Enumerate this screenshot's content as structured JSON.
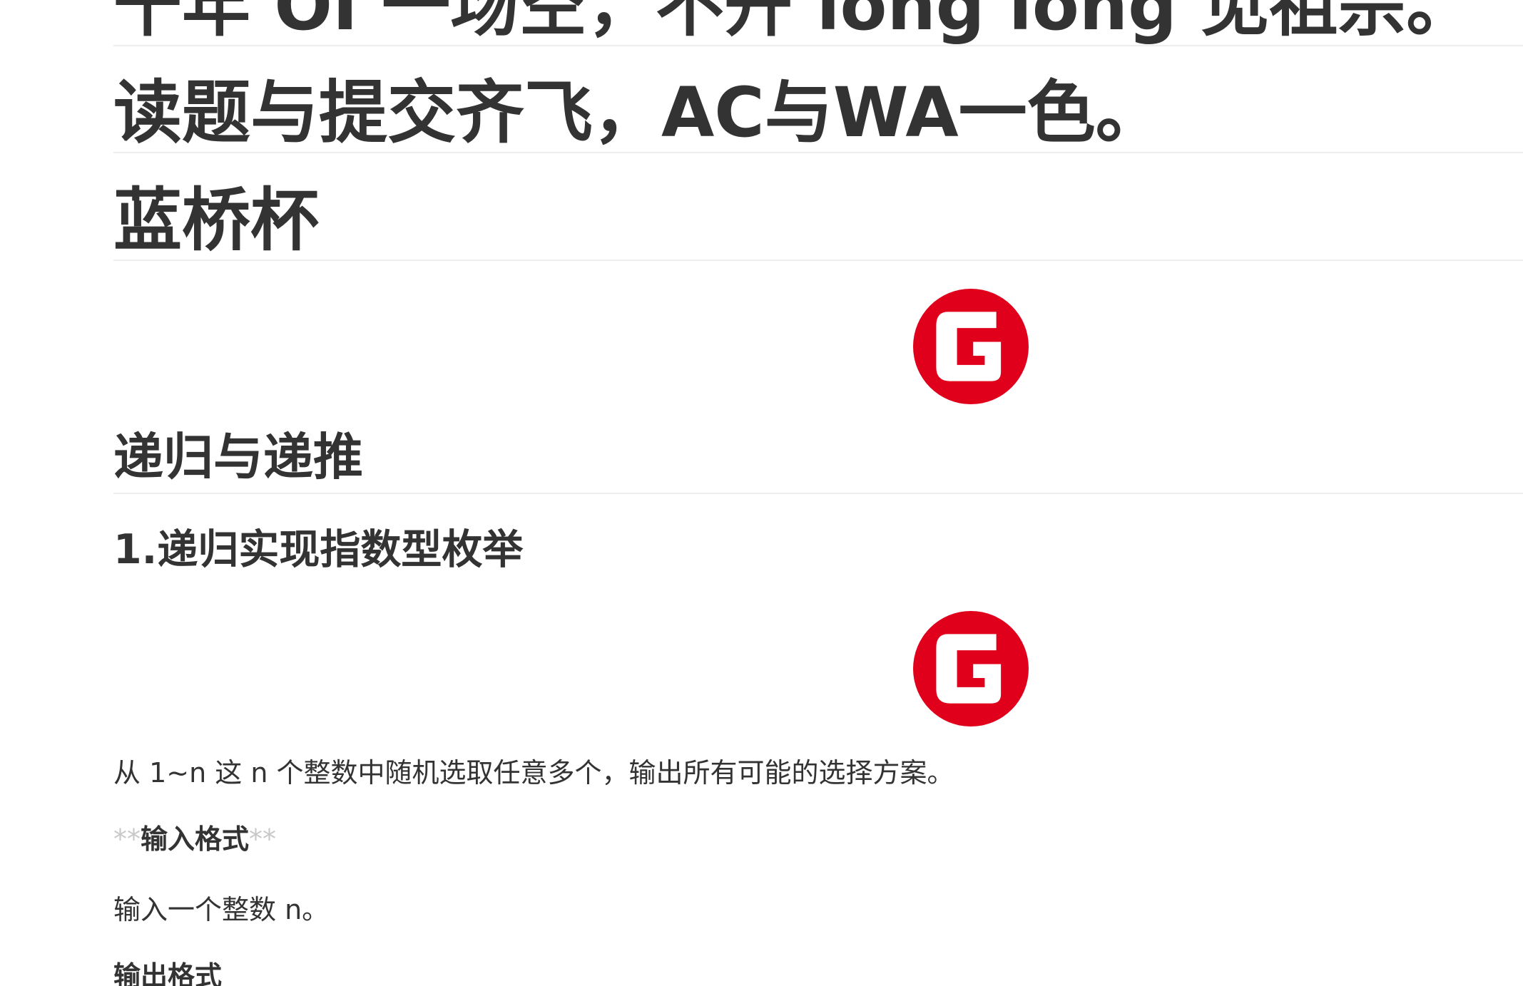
{
  "headings": {
    "line1": "千年 OI 一场空，不开 long long 见祖宗。",
    "line2": "读题与提交齐飞，AC与WA一色。",
    "line3": "蓝桥杯"
  },
  "section": {
    "title": "递归与递推"
  },
  "problem": {
    "title": "1.递归实现指数型枚举",
    "description": "从 1~n 这 n 个整数中随机选取任意多个，输出所有可能的选择方案。",
    "input_mark_open": "**",
    "input_label": "输入格式",
    "input_mark_close": "**",
    "input_text": "输入一个整数 n。",
    "output_label": "输出格式"
  },
  "logo": {
    "icon": "g-logo-icon",
    "color": "#E0001B"
  }
}
